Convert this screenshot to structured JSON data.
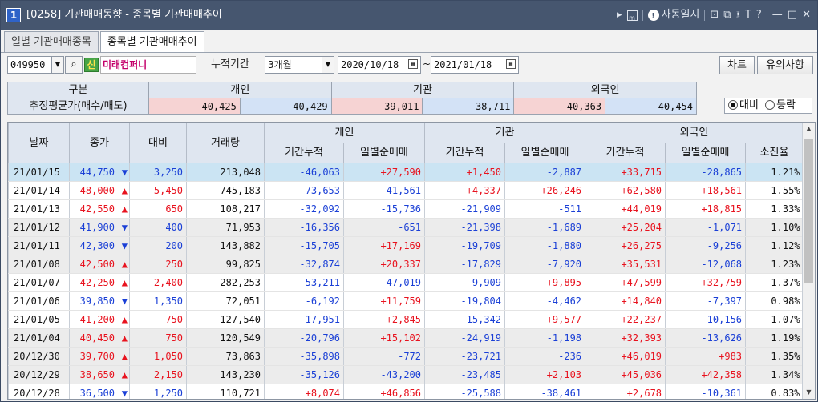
{
  "window": {
    "number": "1",
    "title": "[0258] 기관매매동향 - 종목별 기관매매추이",
    "autolog_label": "자동일지",
    "tools": [
      "m",
      "⊡",
      "⧉",
      "፤",
      "T",
      "?",
      "—",
      "□",
      "✕"
    ]
  },
  "tabs": [
    {
      "label": "일별 기관매매종목",
      "active": false
    },
    {
      "label": "종목별 기관매매추이",
      "active": true
    }
  ],
  "toolbar": {
    "stock_code": "049950",
    "credit_badge": "신",
    "stock_name": "미래컴퍼니",
    "period_label": "누적기간",
    "period_value": "3개월",
    "date_from": "2020/10/18",
    "date_to": "2021/01/18",
    "tilde": "~",
    "chart_button": "차트",
    "notice_button": "유의사항"
  },
  "summary": {
    "header": {
      "category": "구분",
      "individual": "개인",
      "institution": "기관",
      "foreign": "외국인"
    },
    "row_label": "추정평균가(매수/매도)",
    "individual_buy": "40,425",
    "individual_sell": "40,429",
    "institution_buy": "39,011",
    "institution_sell": "38,711",
    "foreign_buy": "40,363",
    "foreign_sell": "40,454"
  },
  "radio": {
    "option1": "대비",
    "option2": "등락",
    "selected": "대비"
  },
  "grid": {
    "headers": {
      "date": "날짜",
      "close": "종가",
      "change": "대비",
      "volume": "거래량",
      "individual": "개인",
      "institution": "기관",
      "foreign": "외국인",
      "cumulative": "기간누적",
      "daily_net": "일별순매매",
      "exhaust_rate": "소진율"
    },
    "rows": [
      {
        "date": "21/01/15",
        "close": "44,750",
        "dir": "down",
        "change": "3,250",
        "volume": "213,048",
        "ind_cum": "-46,063",
        "ind_day": "+27,590",
        "inst_cum": "+1,450",
        "inst_day": "-2,887",
        "for_cum": "+33,715",
        "for_day": "-28,865",
        "rate": "1.21%"
      },
      {
        "date": "21/01/14",
        "close": "48,000",
        "dir": "up",
        "change": "5,450",
        "volume": "745,183",
        "ind_cum": "-73,653",
        "ind_day": "-41,561",
        "inst_cum": "+4,337",
        "inst_day": "+26,246",
        "for_cum": "+62,580",
        "for_day": "+18,561",
        "rate": "1.55%"
      },
      {
        "date": "21/01/13",
        "close": "42,550",
        "dir": "up",
        "change": "650",
        "volume": "108,217",
        "ind_cum": "-32,092",
        "ind_day": "-15,736",
        "inst_cum": "-21,909",
        "inst_day": "-511",
        "for_cum": "+44,019",
        "for_day": "+18,815",
        "rate": "1.33%"
      },
      {
        "date": "21/01/12",
        "close": "41,900",
        "dir": "down",
        "change": "400",
        "volume": "71,953",
        "ind_cum": "-16,356",
        "ind_day": "-651",
        "inst_cum": "-21,398",
        "inst_day": "-1,689",
        "for_cum": "+25,204",
        "for_day": "-1,071",
        "rate": "1.10%"
      },
      {
        "date": "21/01/11",
        "close": "42,300",
        "dir": "down",
        "change": "200",
        "volume": "143,882",
        "ind_cum": "-15,705",
        "ind_day": "+17,169",
        "inst_cum": "-19,709",
        "inst_day": "-1,880",
        "for_cum": "+26,275",
        "for_day": "-9,256",
        "rate": "1.12%"
      },
      {
        "date": "21/01/08",
        "close": "42,500",
        "dir": "up",
        "change": "250",
        "volume": "99,825",
        "ind_cum": "-32,874",
        "ind_day": "+20,337",
        "inst_cum": "-17,829",
        "inst_day": "-7,920",
        "for_cum": "+35,531",
        "for_day": "-12,068",
        "rate": "1.23%"
      },
      {
        "date": "21/01/07",
        "close": "42,250",
        "dir": "up",
        "change": "2,400",
        "volume": "282,253",
        "ind_cum": "-53,211",
        "ind_day": "-47,019",
        "inst_cum": "-9,909",
        "inst_day": "+9,895",
        "for_cum": "+47,599",
        "for_day": "+32,759",
        "rate": "1.37%"
      },
      {
        "date": "21/01/06",
        "close": "39,850",
        "dir": "down",
        "change": "1,350",
        "volume": "72,051",
        "ind_cum": "-6,192",
        "ind_day": "+11,759",
        "inst_cum": "-19,804",
        "inst_day": "-4,462",
        "for_cum": "+14,840",
        "for_day": "-7,397",
        "rate": "0.98%"
      },
      {
        "date": "21/01/05",
        "close": "41,200",
        "dir": "up",
        "change": "750",
        "volume": "127,540",
        "ind_cum": "-17,951",
        "ind_day": "+2,845",
        "inst_cum": "-15,342",
        "inst_day": "+9,577",
        "for_cum": "+22,237",
        "for_day": "-10,156",
        "rate": "1.07%"
      },
      {
        "date": "21/01/04",
        "close": "40,450",
        "dir": "up",
        "change": "750",
        "volume": "120,549",
        "ind_cum": "-20,796",
        "ind_day": "+15,102",
        "inst_cum": "-24,919",
        "inst_day": "-1,198",
        "for_cum": "+32,393",
        "for_day": "-13,626",
        "rate": "1.19%"
      },
      {
        "date": "20/12/30",
        "close": "39,700",
        "dir": "up",
        "change": "1,050",
        "volume": "73,863",
        "ind_cum": "-35,898",
        "ind_day": "-772",
        "inst_cum": "-23,721",
        "inst_day": "-236",
        "for_cum": "+46,019",
        "for_day": "+983",
        "rate": "1.35%"
      },
      {
        "date": "20/12/29",
        "close": "38,650",
        "dir": "up",
        "change": "2,150",
        "volume": "143,230",
        "ind_cum": "-35,126",
        "ind_day": "-43,200",
        "inst_cum": "-23,485",
        "inst_day": "+2,103",
        "for_cum": "+45,036",
        "for_day": "+42,358",
        "rate": "1.34%"
      },
      {
        "date": "20/12/28",
        "close": "36,500",
        "dir": "down",
        "change": "1,250",
        "volume": "110,721",
        "ind_cum": "+8,074",
        "ind_day": "+46,856",
        "inst_cum": "-25,588",
        "inst_day": "-38,461",
        "for_cum": "+2,678",
        "for_day": "-10,361",
        "rate": "0.83%"
      }
    ]
  },
  "colors": {
    "up": "#e8121e",
    "down": "#1a3fd6",
    "titlebar": "#46566f",
    "selected_row": "#cbe4f3",
    "grey_row": "#ececec"
  },
  "icons": {
    "up_arrow": "▲",
    "down_arrow": "▼",
    "search": "🔍",
    "calendar": "▦",
    "dropdown": "▼"
  }
}
